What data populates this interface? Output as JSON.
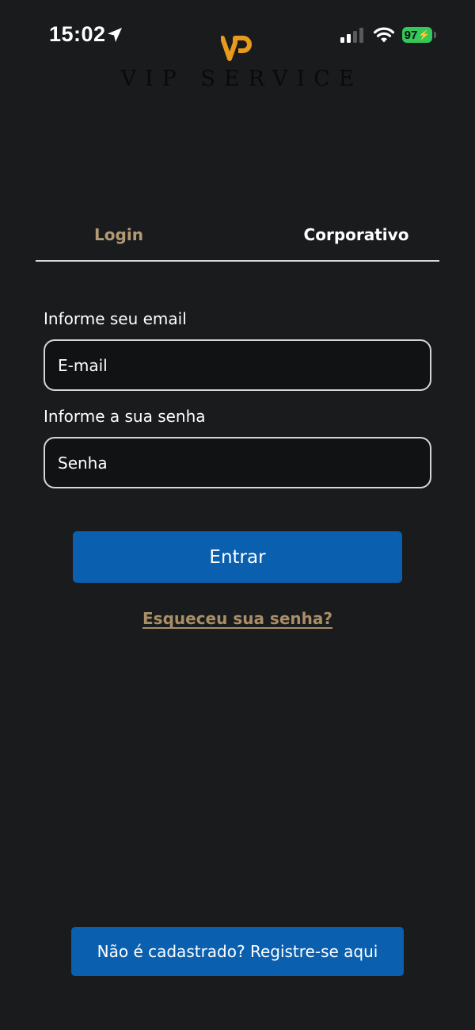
{
  "status_bar": {
    "time": "15:02",
    "battery_level": "97",
    "icons": [
      "location-arrow-icon",
      "cellular-signal-icon",
      "wifi-icon",
      "battery-charging-icon"
    ]
  },
  "brand": {
    "name": "VIP SERVICE",
    "accent_color": "#e89a1d"
  },
  "tabs": [
    {
      "label": "Login",
      "active": true
    },
    {
      "label": "Corporativo",
      "active": false
    }
  ],
  "form": {
    "email_label": "Informe seu email",
    "email_placeholder": "E-mail",
    "password_label": "Informe a sua senha",
    "password_placeholder": "Senha",
    "submit_label": "Entrar",
    "forgot_label": "Esqueceu sua senha?"
  },
  "footer": {
    "register_label": "Não é cadastrado? Registre-se aqui"
  },
  "colors": {
    "background": "#1a1b1d",
    "primary_button": "#0a60af",
    "active_tab": "#b39a74",
    "link": "#a98e67"
  }
}
